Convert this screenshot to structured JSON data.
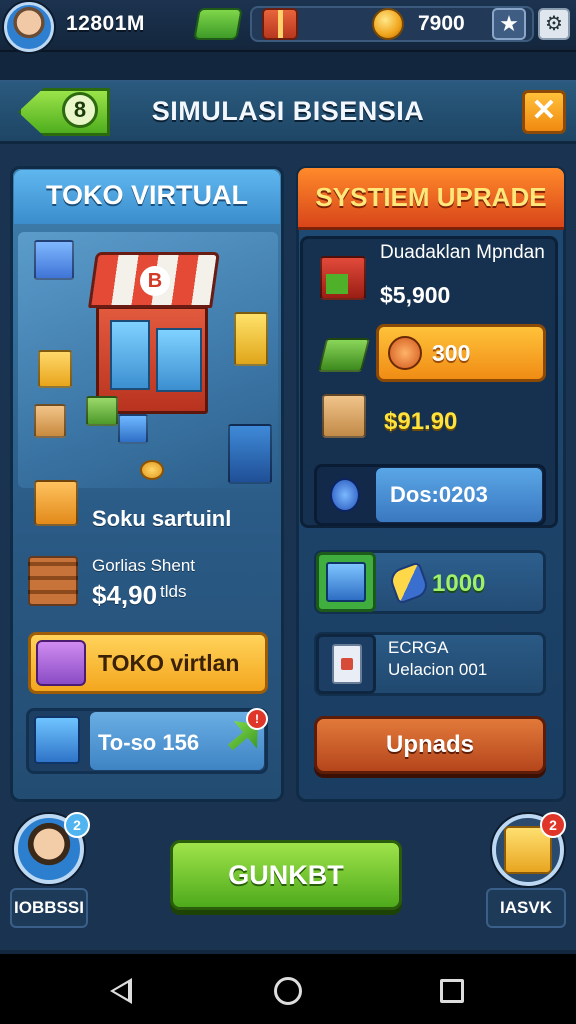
{
  "topbar": {
    "money": "12801M",
    "coins": "7900",
    "icons": [
      "avatar",
      "cash-icon",
      "gift-icon",
      "coin-icon",
      "star-icon",
      "settings-icon"
    ]
  },
  "header": {
    "level": "8",
    "title": "SIMULASI BISENSIA",
    "close": "✕"
  },
  "left_panel": {
    "title": "TOKO VIRTUAL",
    "shop_logo": "B",
    "item_name": "Soku sartuinl",
    "item_line": "Gorlias Shent",
    "item_price": "$4,90",
    "item_unit": "tlds",
    "action_label": "TOKO virtlan",
    "stock_label": "To-so 156",
    "stock_badge": "!"
  },
  "right_panel": {
    "title": "SYSTIEM UPRADE",
    "subtitle": "Duadaklan Mpndan",
    "price_1": "$5,900",
    "pill_value": "300",
    "price_2": "$91.90",
    "dos_label": "Dos:0203",
    "resource_value": "1000",
    "info_line_1": "ECRGA",
    "info_line_2": "Uelacion 001",
    "upgrade_button": "Upnads"
  },
  "bottom": {
    "profile_badge": "2",
    "profile_label": "IOBBSSI",
    "start_button": "GUNKBT",
    "task_badge": "2",
    "task_label": "IASVK"
  },
  "colors": {
    "accent_green": "#4eaa1c",
    "accent_orange": "#f08c14",
    "panel_blue": "#2a5b86",
    "header_orange": "#d8451a"
  }
}
